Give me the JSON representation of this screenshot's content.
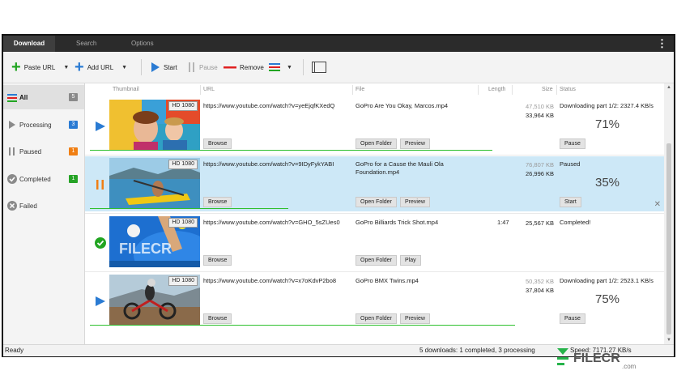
{
  "tabs": [
    {
      "label": "Download",
      "active": true
    },
    {
      "label": "Search",
      "active": false
    },
    {
      "label": "Options",
      "active": false
    }
  ],
  "toolbar": {
    "paste_url": "Paste URL",
    "add_url": "Add URL",
    "start": "Start",
    "pause": "Pause",
    "remove": "Remove"
  },
  "sidebar": [
    {
      "label": "All",
      "count": "5",
      "badge_color": "#8a8a8a",
      "icon": "list-icon"
    },
    {
      "label": "Processing",
      "count": "3",
      "badge_color": "#2a7bd3",
      "icon": "play-icon"
    },
    {
      "label": "Paused",
      "count": "1",
      "badge_color": "#f07f14",
      "icon": "pause-icon"
    },
    {
      "label": "Completed",
      "count": "1",
      "badge_color": "#26a326",
      "icon": "check-circle-icon"
    },
    {
      "label": "Failed",
      "count": "",
      "badge_color": "",
      "icon": "x-circle-icon"
    }
  ],
  "columns": {
    "thumbnail": "Thumbnail",
    "url": "URL",
    "file": "File",
    "length": "Length",
    "size": "Size",
    "status": "Status"
  },
  "downloads": [
    {
      "state": "processing",
      "quality": "HD 1080",
      "url": "https://www.youtube.com/watch?v=yeEjqfKXedQ",
      "file": "GoPro  Are You Okay, Marcos.mp4",
      "length": "",
      "size_done": "47,510 KB",
      "size_total": "33,964 KB",
      "status": "Downloading part 1/2: 2327.4 KB/s",
      "percent": "71%",
      "progress": 0.71,
      "browse": "Browse",
      "open_folder": "Open Folder",
      "action2": "Preview",
      "action3": "Pause"
    },
    {
      "state": "paused",
      "quality": "HD 1080",
      "url": "https://www.youtube.com/watch?v=9IDyFykYABI",
      "file": "GoPro for a Cause  the Mauli Ola Foundation.mp4",
      "length": "",
      "size_done": "76,807 KB",
      "size_total": "26,996 KB",
      "status": "Paused",
      "percent": "35%",
      "progress": 0.35,
      "browse": "Browse",
      "open_folder": "Open Folder",
      "action2": "Preview",
      "action3": "Start"
    },
    {
      "state": "completed",
      "quality": "HD 1080",
      "url": "https://www.youtube.com/watch?v=GHO_5sZUes0",
      "file": "GoPro  Billiards Trick Shot.mp4",
      "length": "1:47",
      "size_done": "",
      "size_total": "25,567 KB",
      "status": "Completed!",
      "percent": "",
      "progress": 1.0,
      "browse": "Browse",
      "open_folder": "Open Folder",
      "action2": "Play",
      "action3": ""
    },
    {
      "state": "processing",
      "quality": "HD 1080",
      "url": "https://www.youtube.com/watch?v=x7oKdvP2bo8",
      "file": "GoPro  BMX Twins.mp4",
      "length": "",
      "size_done": "50,352 KB",
      "size_total": "37,804 KB",
      "status": "Downloading part 1/2: 2523.1 KB/s",
      "percent": "75%",
      "progress": 0.75,
      "browse": "Browse",
      "open_folder": "Open Folder",
      "action2": "Preview",
      "action3": "Pause"
    }
  ],
  "statusbar": {
    "left": "Ready",
    "middle": "5 downloads: 1 completed, 3 processing",
    "speed": "Speed: 7171.27 KB/s"
  },
  "watermark": {
    "thumb_text": "FILECR",
    "corner_text": "FILECR",
    "corner_sub": ".com"
  },
  "colors": {
    "accent_blue": "#2a7bd3",
    "accent_green": "#22a522",
    "accent_orange": "#f07f14",
    "accent_red": "#e02020",
    "selected_row": "#cde8f7"
  }
}
